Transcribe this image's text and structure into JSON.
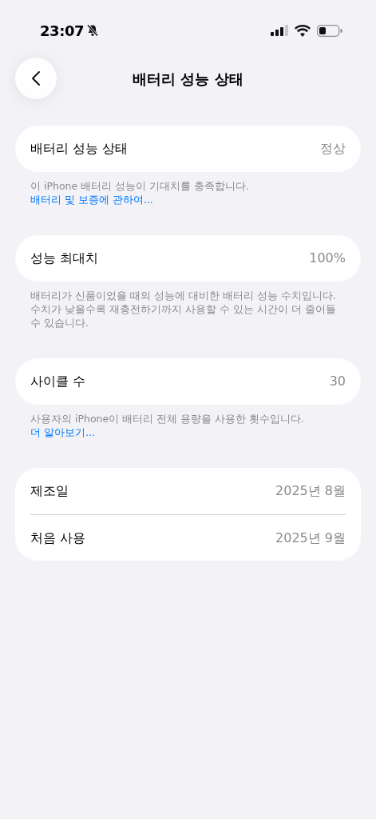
{
  "status_bar": {
    "time": "23:07"
  },
  "nav": {
    "title": "배터리 성능 상태"
  },
  "sections": [
    {
      "rows": [
        {
          "label": "배터리 성능 상태",
          "value": "정상"
        }
      ],
      "footer": {
        "text": "이 iPhone 배터리 성능이 기대치를 충족합니다.",
        "link": "배터리 및 보증에 관하여..."
      }
    },
    {
      "rows": [
        {
          "label": "성능 최대치",
          "value": "100%"
        }
      ],
      "footer": {
        "text": "배터리가 신품이었을 때의 성능에 대비한 배터리 성능 수치입니다. 수치가 낮을수록 재충전하기까지 사용할 수 있는 시간이 더 줄어들 수 있습니다."
      }
    },
    {
      "rows": [
        {
          "label": "사이클 수",
          "value": "30"
        }
      ],
      "footer": {
        "text": "사용자의 iPhone이 배터리 전체 용량을 사용한 횟수입니다.",
        "link": "더 알아보기..."
      }
    },
    {
      "rows": [
        {
          "label": "제조일",
          "value": "2025년 8월"
        },
        {
          "label": "처음 사용",
          "value": "2025년 9월"
        }
      ]
    }
  ]
}
